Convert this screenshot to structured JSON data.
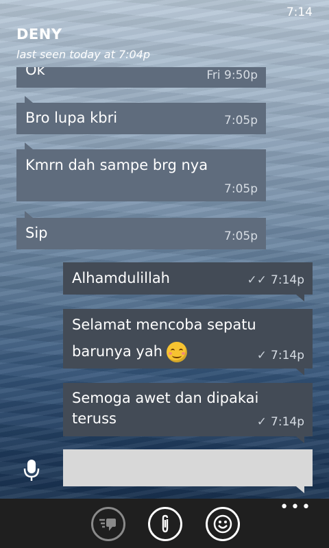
{
  "status_bar": {
    "time": "7:14"
  },
  "header": {
    "contact_name": "DENY",
    "last_seen": "last seen today at 7:04p"
  },
  "messages": [
    {
      "direction": "in",
      "text": "Ok",
      "time": "Fri 9:50p"
    },
    {
      "direction": "in",
      "text": "Bro lupa kbri",
      "time": "7:05p"
    },
    {
      "direction": "in",
      "text": "Kmrn dah sampe brg nya",
      "time": "7:05p"
    },
    {
      "direction": "in",
      "text": "Sip",
      "time": "7:05p"
    },
    {
      "direction": "out",
      "text": "Alhamdulillah",
      "time": "7:14p",
      "status": "double-check"
    },
    {
      "direction": "out",
      "line1": "Selamat mencoba sepatu",
      "line2": "barunya yah",
      "emoji": "smiling-face-emoji",
      "time": "7:14p",
      "status": "check"
    },
    {
      "direction": "out",
      "line1": "Semoga awet dan dipakai",
      "line2": "teruss",
      "time": "7:14p",
      "status": "check"
    }
  ],
  "composer": {
    "placeholder": "",
    "mic_icon": "microphone-icon"
  },
  "app_bar": {
    "buttons": [
      {
        "icon": "emoji-keyboard-icon",
        "state": "disabled"
      },
      {
        "icon": "attach-icon",
        "state": "enabled"
      },
      {
        "icon": "smiley-icon",
        "state": "enabled"
      }
    ],
    "more_icon": "ellipsis-icon"
  },
  "colors": {
    "incoming_bubble": "#5f6c7d",
    "outgoing_bubble": "#434b56",
    "app_bar": "#1f1f1f",
    "input": "#d8d8d8"
  }
}
